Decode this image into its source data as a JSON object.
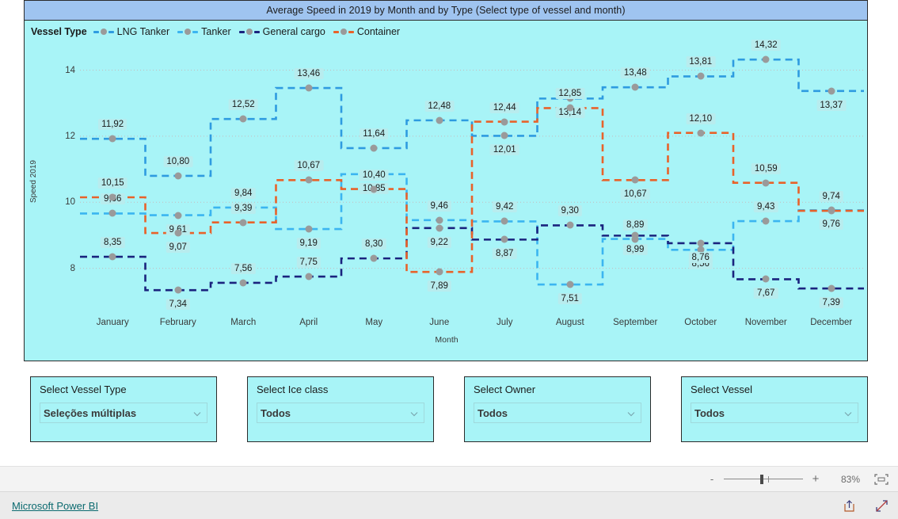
{
  "chart": {
    "title": "Average Speed in 2019 by Month and by Type (Select type of vessel and month)",
    "legend_title": "Vessel Type"
  },
  "chart_data": {
    "type": "line",
    "line_style": "step-dashed",
    "title": "Average Speed in 2019 by Month and by Type (Select type of vessel and month)",
    "xlabel": "Month",
    "ylabel": "Speed 2019",
    "ylim": [
      6.6,
      14.9
    ],
    "yticks": [
      8,
      10,
      12,
      14
    ],
    "grid": true,
    "legend_position": "top-left",
    "categories": [
      "January",
      "February",
      "March",
      "April",
      "May",
      "June",
      "July",
      "August",
      "September",
      "October",
      "November",
      "December"
    ],
    "series": [
      {
        "name": "LNG Tanker",
        "color": "#2E9BE0",
        "values": [
          11.92,
          10.8,
          12.52,
          13.46,
          11.64,
          12.48,
          12.01,
          13.14,
          13.48,
          13.81,
          14.32,
          13.37
        ]
      },
      {
        "name": "Tanker",
        "color": "#3BB5F0",
        "values": [
          9.66,
          9.61,
          9.84,
          9.19,
          10.85,
          9.46,
          9.42,
          7.51,
          8.89,
          8.56,
          9.43,
          9.76
        ]
      },
      {
        "name": "General cargo",
        "color": "#1A237E",
        "values": [
          8.35,
          7.34,
          7.56,
          7.75,
          8.3,
          9.22,
          8.87,
          9.3,
          8.99,
          8.76,
          7.67,
          7.39
        ]
      },
      {
        "name": "Container",
        "color": "#E8622A",
        "values": [
          10.15,
          9.07,
          9.39,
          10.67,
          10.4,
          7.89,
          12.44,
          12.85,
          10.67,
          12.1,
          10.59,
          9.74
        ]
      }
    ]
  },
  "slicers": [
    {
      "title": "Select Vessel Type",
      "value": "Seleções múltiplas",
      "icon": "chevron-down-icon"
    },
    {
      "title": "Select Ice class",
      "value": "Todos",
      "icon": "chevron-down-icon"
    },
    {
      "title": "Select Owner",
      "value": "Todos",
      "icon": "chevron-down-icon"
    },
    {
      "title": "Select Vessel",
      "value": "Todos",
      "icon": "chevron-down-icon"
    }
  ],
  "zoombar": {
    "minus_label": "-",
    "plus_label": "+",
    "percent": "83%",
    "fit_icon": "fit-to-page-icon"
  },
  "footer": {
    "brand": "Microsoft Power BI",
    "share_icon": "share-icon",
    "fullscreen_icon": "fullscreen-icon"
  }
}
